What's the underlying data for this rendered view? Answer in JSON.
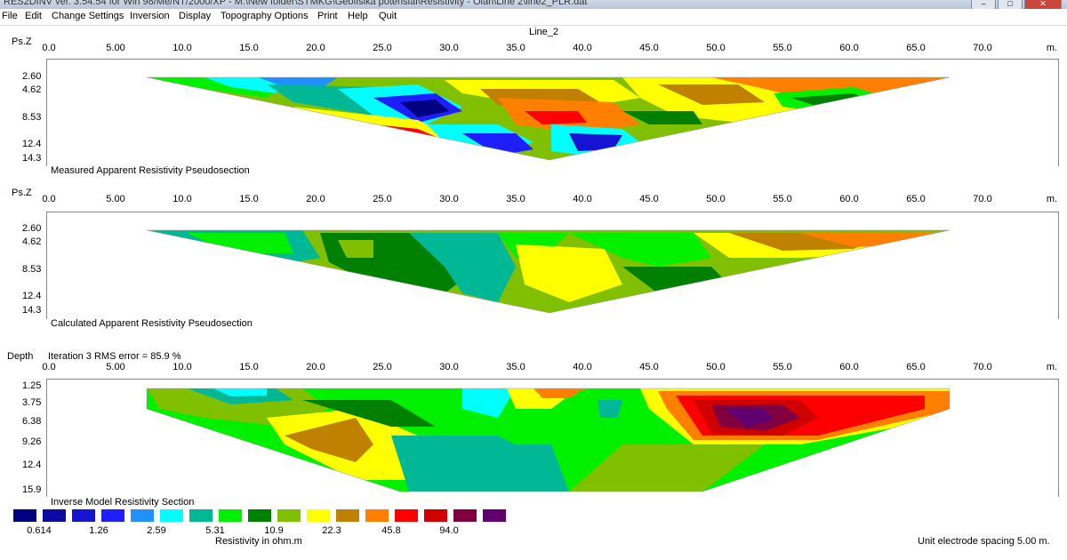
{
  "window": {
    "title": "RES2DINV ver. 3.54.54 for Win 98/Me/NT/2000/XP - M:\\New folder\\STMKG\\Geofisika potensial\\Resistivity - Olah\\Line 2\\line2_PLR.dat",
    "btn_min": "–",
    "btn_max": "□",
    "btn_close": "✕"
  },
  "menu": [
    "File",
    "Edit",
    "Change Settings",
    "Inversion",
    "Display",
    "Topography Options",
    "Print",
    "Help",
    "Quit"
  ],
  "line_title": "Line_2",
  "x_ticks": [
    "0.0",
    "5.00",
    "10.0",
    "15.0",
    "20.0",
    "25.0",
    "30.0",
    "35.0",
    "40.0",
    "45.0",
    "50.0",
    "55.0",
    "60.0",
    "65.0",
    "70.0"
  ],
  "x_unit": "m.",
  "panels": [
    {
      "axis_label": "Ps.Z",
      "depths": [
        "2.60",
        "4.62",
        "8.53",
        "12.4",
        "14.3"
      ],
      "caption": "Measured Apparent Resistivity Pseudosection"
    },
    {
      "axis_label": "Ps.Z",
      "depths": [
        "2.60",
        "4.62",
        "8.53",
        "12.4",
        "14.3"
      ],
      "caption": "Calculated Apparent Resistivity Pseudosection"
    },
    {
      "axis_label": "Depth",
      "depths": [
        "1.25",
        "3.75",
        "6.38",
        "9.26",
        "12.4",
        "15.9"
      ],
      "caption": "Inverse Model Resistivity Section",
      "iteration": "Iteration 3 RMS error = 85.9 %"
    }
  ],
  "legend": {
    "colors": [
      "#000080",
      "#0a0aa5",
      "#1414d2",
      "#1e1eff",
      "#2090ff",
      "#00ffff",
      "#00b896",
      "#00f000",
      "#008000",
      "#80c000",
      "#ffff00",
      "#c08000",
      "#ff8000",
      "#ff0000",
      "#d00000",
      "#800040",
      "#600070"
    ],
    "values": [
      "0.614",
      "1.26",
      "2.59",
      "5.31",
      "10.9",
      "22.3",
      "45.8",
      "94.0"
    ],
    "unit_label": "Resistivity in ohm.m"
  },
  "footer": "Unit electrode spacing 5.00 m."
}
